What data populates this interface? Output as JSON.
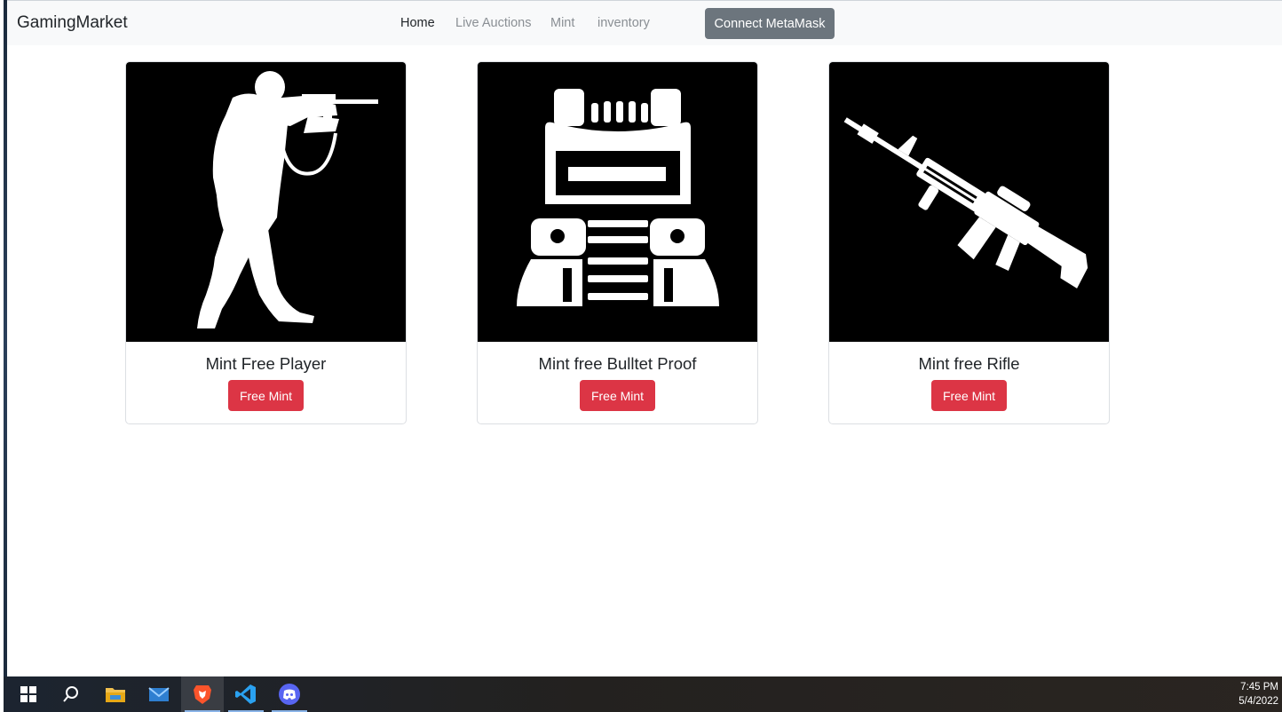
{
  "navbar": {
    "brand": "GamingMarket",
    "links": [
      {
        "label": "Home"
      },
      {
        "label": "Live Auctions"
      },
      {
        "label": "Mint"
      },
      {
        "label": "inventory"
      }
    ],
    "connect_label": "Connect MetaMask"
  },
  "cards": [
    {
      "title": "Mint Free Player",
      "button": "Free Mint",
      "icon": "soldier-silhouette-icon"
    },
    {
      "title": "Mint free Bulltet Proof",
      "button": "Free Mint",
      "icon": "bulletproof-vest-icon"
    },
    {
      "title": "Mint free Rifle",
      "button": "Free Mint",
      "icon": "rifle-icon"
    }
  ],
  "taskbar": {
    "apps": [
      "windows-start-icon",
      "search-icon",
      "file-explorer-icon",
      "mail-icon",
      "brave-browser-icon",
      "vscode-icon",
      "discord-icon"
    ],
    "time": "7:45 PM",
    "date": "5/4/2022"
  },
  "colors": {
    "primary_danger": "#dc3545",
    "secondary": "#6c757d",
    "navbar_bg": "#f8f9fa"
  }
}
